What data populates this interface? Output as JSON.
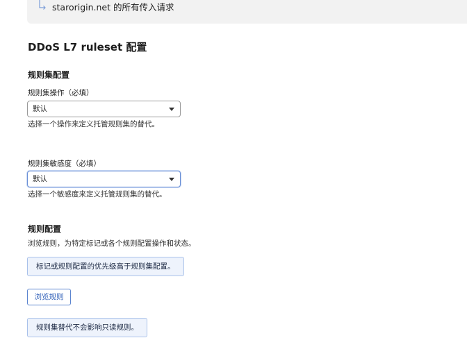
{
  "top_banner": {
    "text": "starorigin.net 的所有传入请求",
    "icon": "return-arrow-icon"
  },
  "section_title": "DDoS L7 ruleset 配置",
  "ruleset_config": {
    "heading": "规则集配置",
    "action": {
      "label": "规则集操作（必填）",
      "value": "默认",
      "help": "选择一个操作来定义托管规则集的替代。"
    },
    "sensitivity": {
      "label": "规则集敏感度（必填）",
      "value": "默认",
      "help": "选择一个敏感度来定义托管规则集的替代。"
    }
  },
  "rule_config": {
    "heading": "规则配置",
    "description": "浏览规则，为特定标记或各个规则配置操作和状态。",
    "priority_note": "标记或规则配置的优先级高于规则集配置。",
    "browse_button": "浏览规则",
    "readonly_note": "规则集替代不会影响只读规则。"
  },
  "colors": {
    "accent": "#2f5fb8",
    "info_bg": "#eef3fc",
    "info_border": "#a9c1ea",
    "banner_bg": "#f2f2f2"
  }
}
